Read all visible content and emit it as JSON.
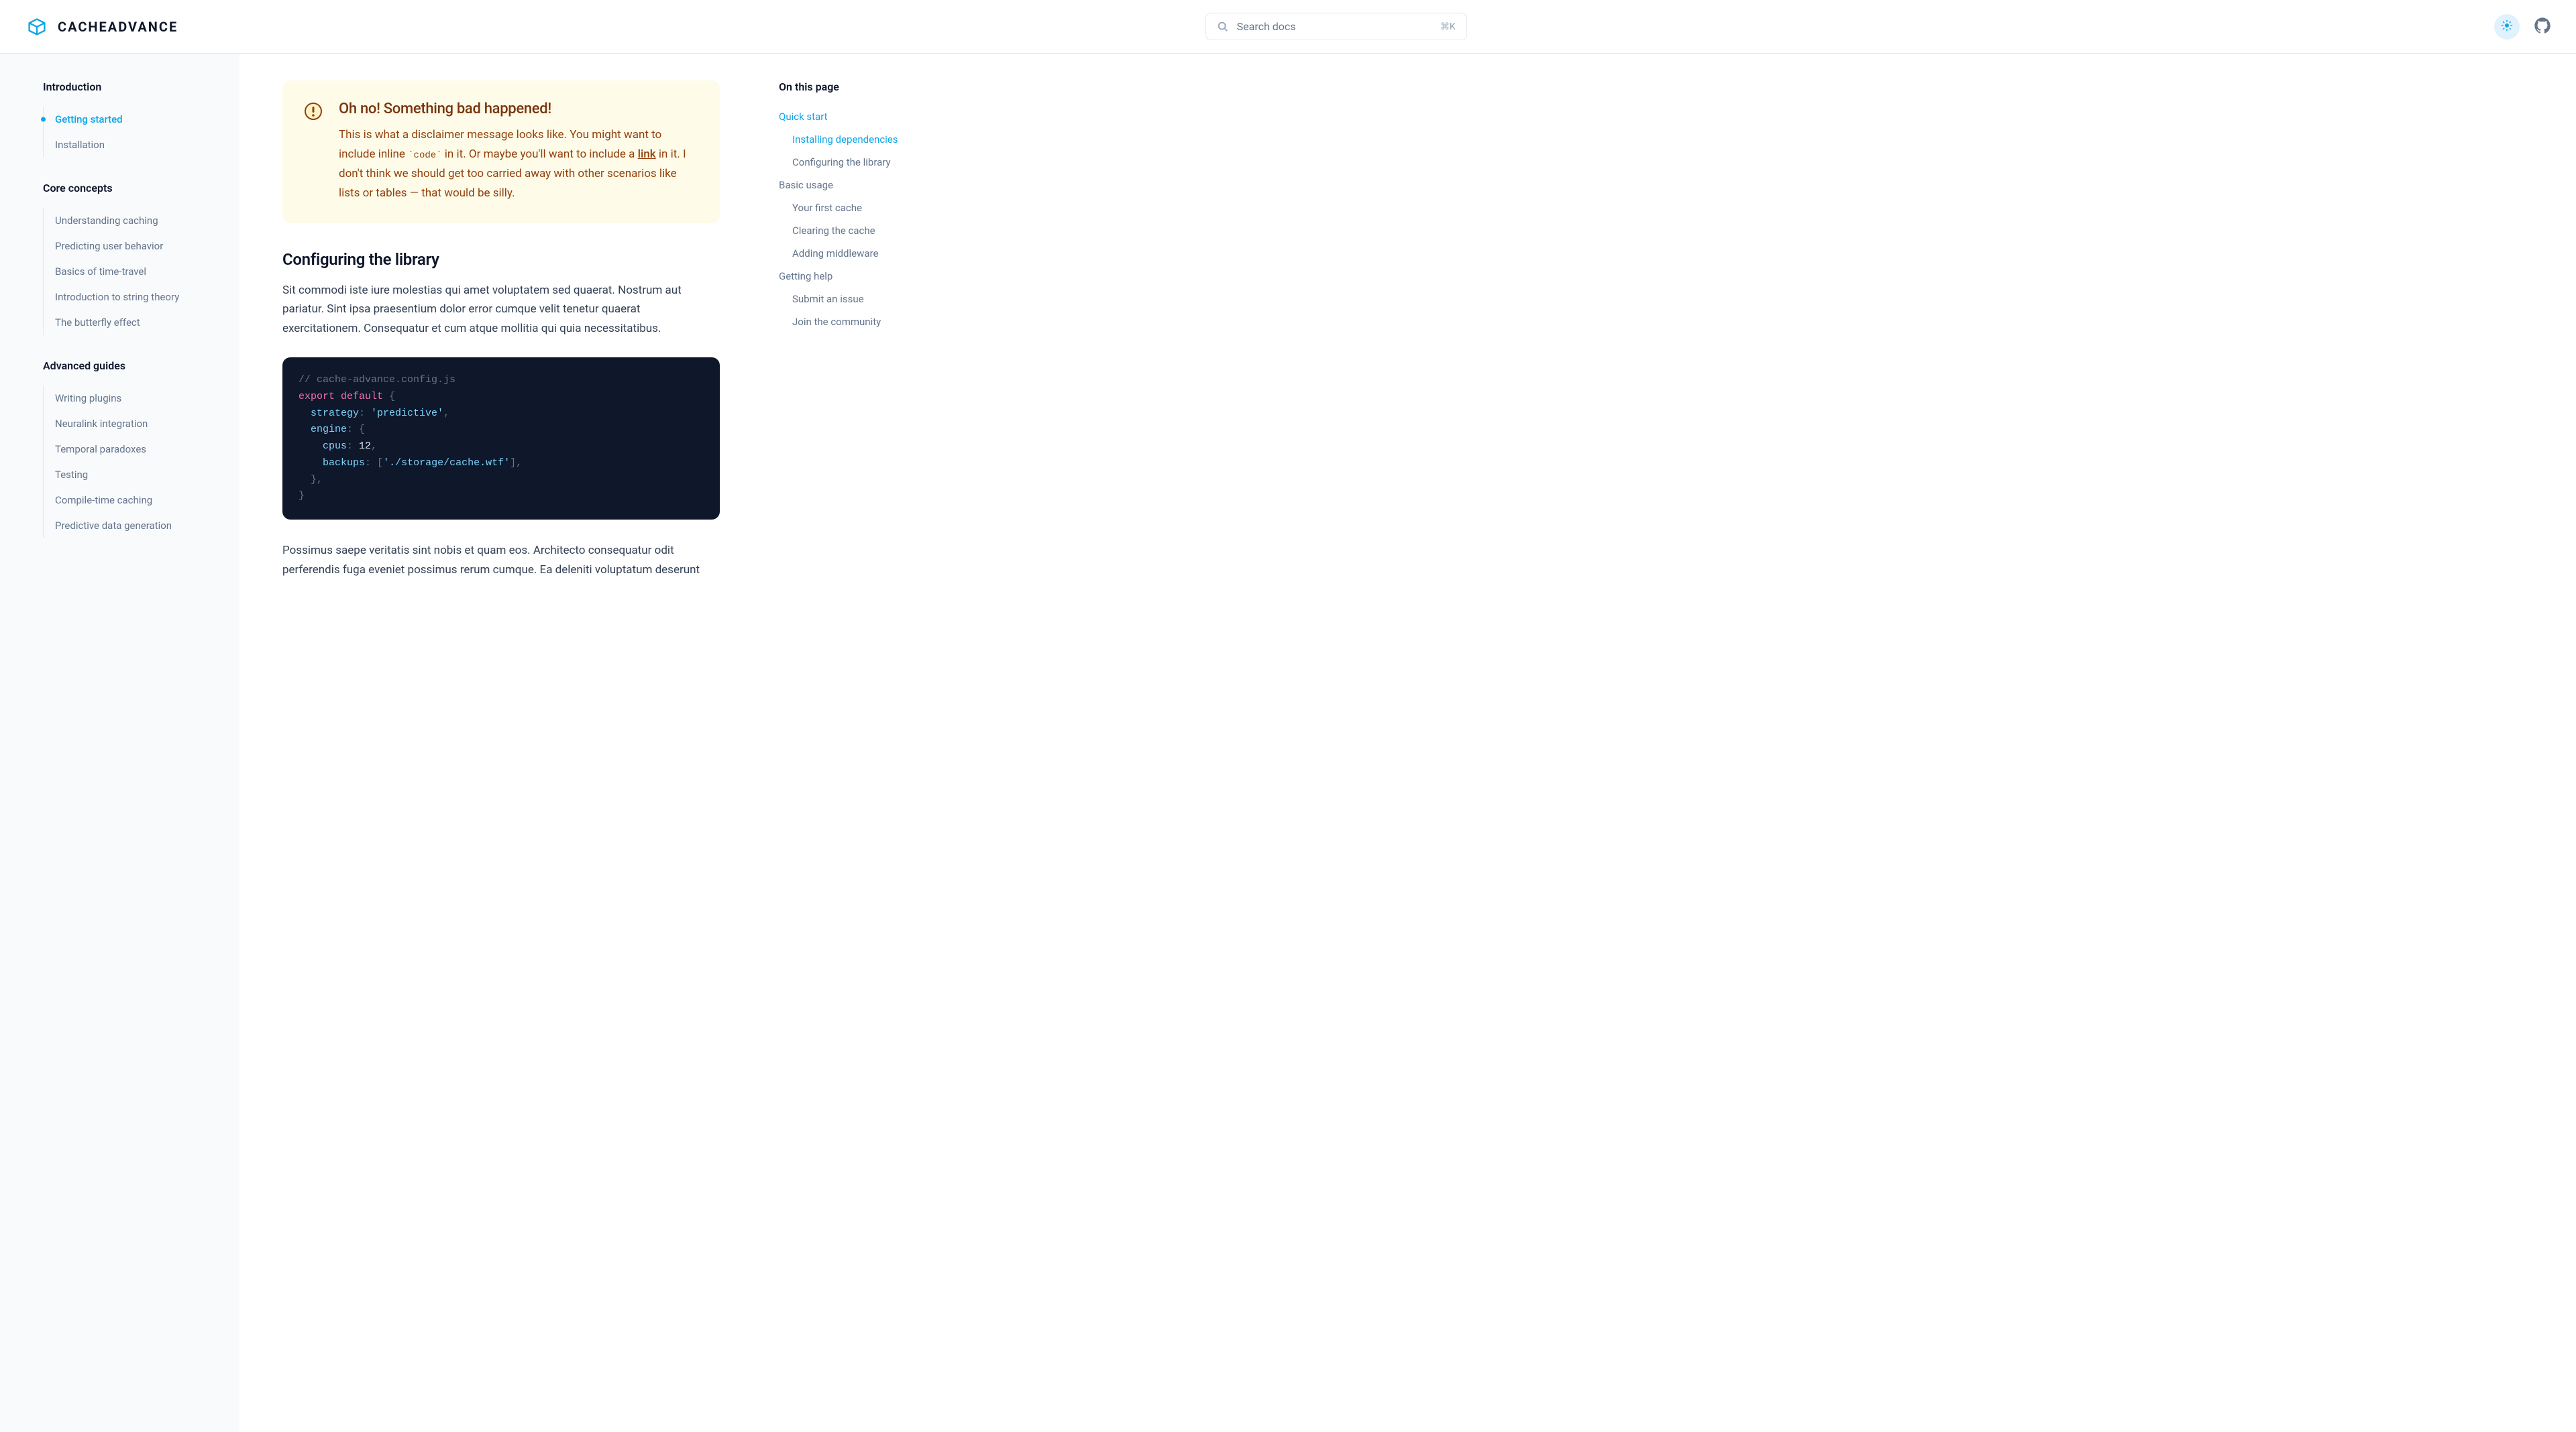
{
  "header": {
    "brand": "CACHEADVANCE",
    "search_placeholder": "Search docs",
    "search_shortcut": "⌘K"
  },
  "sidebar": {
    "sections": [
      {
        "title": "Introduction",
        "items": [
          "Getting started",
          "Installation"
        ],
        "active_index": 0
      },
      {
        "title": "Core concepts",
        "items": [
          "Understanding caching",
          "Predicting user behavior",
          "Basics of time-travel",
          "Introduction to string theory",
          "The butterfly effect"
        ]
      },
      {
        "title": "Advanced guides",
        "items": [
          "Writing plugins",
          "Neuralink integration",
          "Temporal paradoxes",
          "Testing",
          "Compile-time caching",
          "Predictive data generation"
        ]
      }
    ]
  },
  "callout": {
    "title": "Oh no! Something bad happened!",
    "text_before": "This is what a disclaimer message looks like. You might want to include inline ",
    "code": "`code`",
    "text_mid": " in it. Or maybe you'll want to include a ",
    "link": "link",
    "text_after": " in it. I don't think we should get too carried away with other scenarios like lists or tables — that would be silly."
  },
  "section": {
    "heading": "Configuring the library",
    "para1": "Sit commodi iste iure molestias qui amet voluptatem sed quaerat. Nostrum aut pariatur. Sint ipsa praesentium dolor error cumque velit tenetur quaerat exercitationem. Consequatur et cum atque mollitia qui quia necessitatibus.",
    "para2": "Possimus saepe veritatis sint nobis et quam eos. Architecto consequatur odit perferendis fuga eveniet possimus rerum cumque. Ea deleniti voluptatum deserunt"
  },
  "code": {
    "comment": "// cache-advance.config.js",
    "kw_export": "export",
    "kw_default": "default",
    "brace_open": " {",
    "l_strategy": "  strategy",
    "colon1": ": ",
    "v_strategy": "'predictive'",
    "comma1": ",",
    "l_engine": "  engine",
    "colon2": ": ",
    "brace_open2": "{",
    "l_cpus": "    cpus",
    "colon3": ": ",
    "v_cpus": "12",
    "comma2": ",",
    "l_backups": "    backups",
    "colon4": ": ",
    "bracket_open": "[",
    "v_backups": "'./storage/cache.wtf'",
    "bracket_close": "]",
    "comma3": ",",
    "brace_close2": "  }",
    "comma4": ",",
    "brace_close": "}"
  },
  "toc": {
    "title": "On this page",
    "items": [
      {
        "label": "Quick start",
        "level": 1,
        "active": true
      },
      {
        "label": "Installing dependencies",
        "level": 2,
        "active": true
      },
      {
        "label": "Configuring the library",
        "level": 2
      },
      {
        "label": "Basic usage",
        "level": 1
      },
      {
        "label": "Your first cache",
        "level": 2
      },
      {
        "label": "Clearing the cache",
        "level": 2
      },
      {
        "label": "Adding middleware",
        "level": 2
      },
      {
        "label": "Getting help",
        "level": 1
      },
      {
        "label": "Submit an issue",
        "level": 2
      },
      {
        "label": "Join the community",
        "level": 2
      }
    ]
  }
}
